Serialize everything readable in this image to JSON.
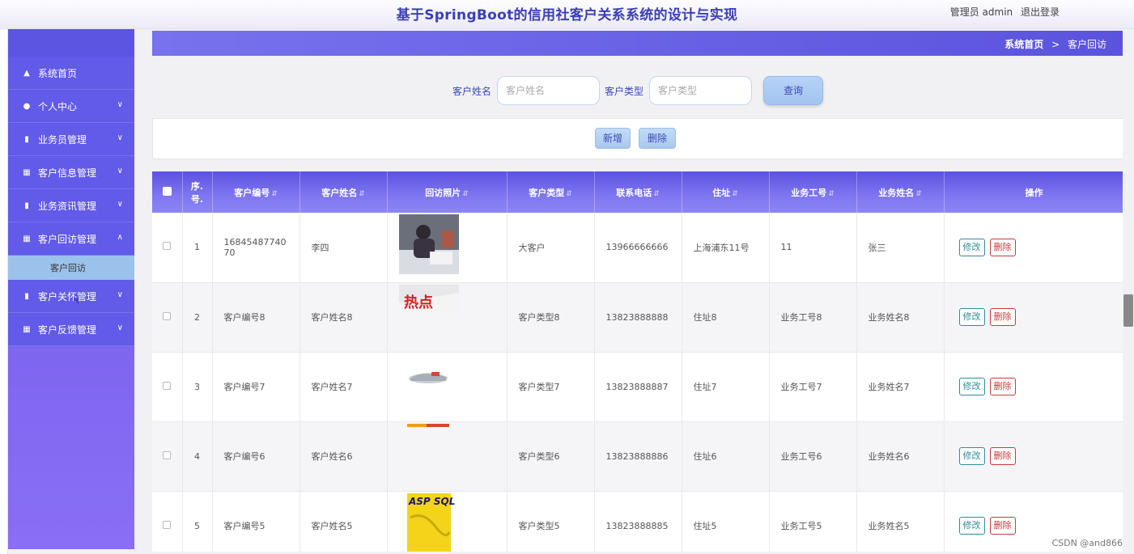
{
  "header": {
    "title": "基于SpringBoot的信用社客户关系系统的设计与实现",
    "user_label": "管理员 admin",
    "logout_label": "退出登录"
  },
  "sidebar": {
    "items": [
      {
        "label": "系统首页",
        "icon": "home-icon"
      },
      {
        "label": "个人中心",
        "icon": "user-icon"
      },
      {
        "label": "业务员管理",
        "icon": "card-icon"
      },
      {
        "label": "客户信息管理",
        "icon": "grid-icon"
      },
      {
        "label": "业务资讯管理",
        "icon": "bowtie-icon"
      },
      {
        "label": "客户回访管理",
        "icon": "grid-icon"
      },
      {
        "label": "客户关怀管理",
        "icon": "card-icon"
      },
      {
        "label": "客户反馈管理",
        "icon": "grid-icon"
      }
    ],
    "sub_item": "客户回访"
  },
  "breadcrumb": {
    "home": "系统首页",
    "separator": ">",
    "current": "客户回访"
  },
  "search": {
    "name_label": "客户姓名",
    "name_placeholder": "客户姓名",
    "type_label": "客户类型",
    "type_placeholder": "客户类型",
    "query_label": "查询"
  },
  "actions": {
    "add_label": "新增",
    "delete_label": "删除"
  },
  "table": {
    "headers": [
      "序号",
      "客户编号",
      "客户姓名",
      "回访照片",
      "客户类型",
      "联系电话",
      "住址",
      "业务工号",
      "业务姓名",
      "操作"
    ],
    "index_header_line1": "序.",
    "index_header_line2": "号.",
    "edit_label": "修改",
    "delete_label": "删除",
    "rows": [
      {
        "index": "1",
        "code": "1684548774070",
        "name": "李四",
        "photo": "photo-person",
        "type": "大客户",
        "phone": "13966666666",
        "address": "上海浦东11号",
        "staff_id": "11",
        "staff_name": "张三"
      },
      {
        "index": "2",
        "code": "客户编号8",
        "name": "客户姓名8",
        "photo": "photo-redo",
        "type": "客户类型8",
        "phone": "13823888888",
        "address": "住址8",
        "staff_id": "业务工号8",
        "staff_name": "业务姓名8"
      },
      {
        "index": "3",
        "code": "客户编号7",
        "name": "客户姓名7",
        "photo": "photo-sneaker",
        "type": "客户类型7",
        "phone": "13823888887",
        "address": "住址7",
        "staff_id": "业务工号7",
        "staff_name": "业务姓名7"
      },
      {
        "index": "4",
        "code": "客户编号6",
        "name": "客户姓名6",
        "photo": "photo-strip",
        "type": "客户类型6",
        "phone": "13823888886",
        "address": "住址6",
        "staff_id": "业务工号6",
        "staff_name": "业务姓名6"
      },
      {
        "index": "5",
        "code": "客户编号5",
        "name": "客户姓名5",
        "photo": "photo-book",
        "type": "客户类型5",
        "phone": "13823888885",
        "address": "住址5",
        "staff_id": "业务工号5",
        "staff_name": "业务姓名5"
      }
    ],
    "photo_texts": {
      "redo": "热点",
      "book": "ASP SQL"
    }
  },
  "watermark": "CSDN @and866"
}
